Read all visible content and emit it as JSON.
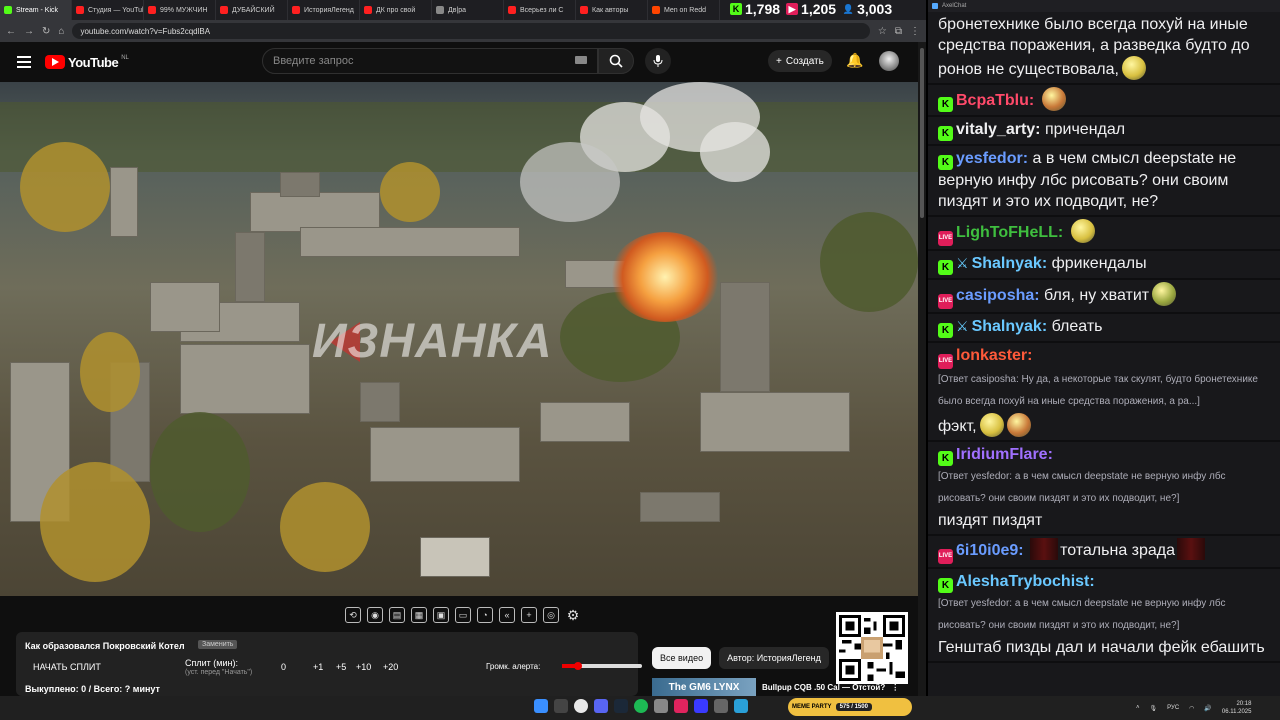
{
  "browser": {
    "tabs": [
      {
        "label": "Stream - Kick",
        "color": "#53fc18"
      },
      {
        "label": "Студия — YouTube",
        "color": "#ff2020"
      },
      {
        "label": "99% МУЖЧИН",
        "color": "#ff2020"
      },
      {
        "label": "ДУБАЙСКИЙ",
        "color": "#ff2020"
      },
      {
        "label": "ИсторияЛегенд",
        "color": "#ff2020"
      },
      {
        "label": "ДК про свой",
        "color": "#ff2020"
      },
      {
        "label": "Дв|ра",
        "color": "#888888"
      },
      {
        "label": "Всерьез ли С",
        "color": "#ff2020"
      },
      {
        "label": "Как авторы",
        "color": "#ff2020"
      },
      {
        "label": "Men on Redd",
        "color": "#ff4500"
      }
    ],
    "url": "youtube.com/watch?v=Fubs2cqdlBA"
  },
  "viewer_counts": {
    "kick": "1,798",
    "live": "1,205",
    "total": "3,003"
  },
  "youtube": {
    "logo_text": "YouTube",
    "region": "NL",
    "search_placeholder": "Введите запрос",
    "create_label": "Создать"
  },
  "video": {
    "watermark": "ИЗНАНКА"
  },
  "split_panel": {
    "title": "Как образовался Покровский Котел",
    "badge": "Заменить",
    "start_button": "НАЧАТЬ СПЛИТ",
    "split_label": "Сплит (мин):",
    "split_hint": "(уст. перед \"Начать\")",
    "split_value": "0",
    "inc_buttons": [
      "+1",
      "+5",
      "+10",
      "+20"
    ],
    "alert_label": "Громк. алерта:",
    "paid_line": "Выкуплено: 0 / Всего: ? минут",
    "alert_volume_percent": 20
  },
  "chips": [
    "Все видео",
    "Автор: ИсторияЛегенд"
  ],
  "recommendation": {
    "thumb_text": "The GM6 LYNX",
    "title": "Bullpup CQB .50 Cal — Отстой?"
  },
  "chat": {
    "window_title": "AxelChat",
    "messages": [
      {
        "badge": "",
        "nick": "",
        "nick_color": "#ffffff",
        "text": "бронетехнике было всегда похуй на иные средства поражения, а разведка будто до ронов не существовала,",
        "reply": "",
        "emotes": 1,
        "blur": false
      },
      {
        "badge": "kick",
        "nick": "BcpaTblu:",
        "nick_color": "#ff4a6a",
        "text": "",
        "reply": "",
        "emotes": 1,
        "blur": false
      },
      {
        "badge": "kick",
        "nick": "vitaly_arty:",
        "nick_color": "#efeff1",
        "text": "причендал",
        "reply": "",
        "emotes": 0,
        "blur": false
      },
      {
        "badge": "kick",
        "nick": "yesfedor:",
        "nick_color": "#6a9cff",
        "text": "а в чем смысл deepstate не верную инфу лбс рисовать? они своим пиздят и это их подводит, не?",
        "reply": "",
        "emotes": 0,
        "blur": false
      },
      {
        "badge": "live",
        "nick": "LighToFHeLL:",
        "nick_color": "#3fbf3f",
        "text": "",
        "reply": "",
        "emotes": 1,
        "blur": false
      },
      {
        "badge": "kick-sword",
        "nick": "Shalnyak:",
        "nick_color": "#6ac8ff",
        "text": "фрикендалы",
        "reply": "",
        "emotes": 0,
        "blur": false
      },
      {
        "badge": "live",
        "nick": "casiposha:",
        "nick_color": "#6a9cff",
        "text": "бля, ну хватит",
        "reply": "",
        "emotes": 1,
        "blur": false
      },
      {
        "badge": "kick-sword",
        "nick": "Shalnyak:",
        "nick_color": "#6ac8ff",
        "text": "блеать",
        "reply": "",
        "emotes": 0,
        "blur": false
      },
      {
        "badge": "live",
        "nick": "lonkaster:",
        "nick_color": "#ff5a3a",
        "text": "фэкт,",
        "reply": "[Ответ casiposha: Ну да, а некоторые так скулят, будто бронетехнике было всегда похуй на иные средства поражения, а ра...]",
        "emotes": 2,
        "blur": false
      },
      {
        "badge": "kick",
        "nick": "IridiumFlare:",
        "nick_color": "#a070ff",
        "text": "пиздят пиздят",
        "reply": "[Ответ yesfedor: а в чем смысл deepstate не верную инфу лбс рисовать? они своим пиздят и это их подводит, не?]",
        "emotes": 0,
        "blur": false
      },
      {
        "badge": "live",
        "nick": "6i10i0e9:",
        "nick_color": "#6a9cff",
        "text": "тотальна зрада",
        "reply": "",
        "emotes": 0,
        "blur": true
      },
      {
        "badge": "kick",
        "nick": "AleshaTrybochist:",
        "nick_color": "#6ac8ff",
        "text": "Генштаб пизды дал и начали фейк ебашить",
        "reply": "[Ответ yesfedor: а в чем смысл deepstate не верную инфу лбс рисовать? они своим пиздят и это их подводит, не?]",
        "emotes": 0,
        "blur": false
      }
    ]
  },
  "taskbar": {
    "kick_widget_text": "MEME PARTY",
    "kick_widget_value": "575 / 1500",
    "language": "РУС",
    "time": "20:18",
    "date": "06.11.2025"
  },
  "colors": {
    "kick_green": "#53fc18",
    "youtube_red": "#ff0000",
    "live_pink": "#e01e5a"
  }
}
